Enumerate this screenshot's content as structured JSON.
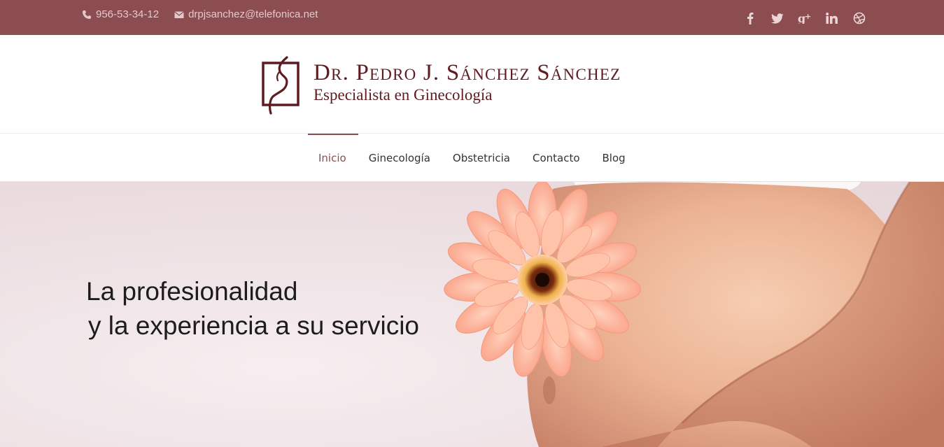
{
  "topbar": {
    "phone": "956-53-34-12",
    "email": "drpjsanchez@telefonica.net",
    "phone_icon": "phone-icon",
    "email_icon": "envelope-icon",
    "social": [
      {
        "name": "facebook-icon",
        "glyph": "f"
      },
      {
        "name": "twitter-icon",
        "glyph": "t"
      },
      {
        "name": "google-plus-icon",
        "glyph": "g+"
      },
      {
        "name": "linkedin-icon",
        "glyph": "in"
      },
      {
        "name": "dribbble-icon",
        "glyph": "◎"
      }
    ]
  },
  "brand": {
    "title": "Dr. Pedro J. Sánchez Sánchez",
    "subtitle": "Especialista en Ginecología",
    "color": "#5e1b20"
  },
  "nav": {
    "items": [
      {
        "label": "Inicio",
        "active": true
      },
      {
        "label": "Ginecología",
        "active": false
      },
      {
        "label": "Obstetricia",
        "active": false
      },
      {
        "label": "Contacto",
        "active": false
      },
      {
        "label": "Blog",
        "active": false
      }
    ]
  },
  "hero": {
    "line1": "La profesionalidad",
    "line2": "y la experiencia a su servicio"
  },
  "colors": {
    "topbar": "#8c4d51",
    "accent": "#8c4d51",
    "text": "#333333"
  }
}
